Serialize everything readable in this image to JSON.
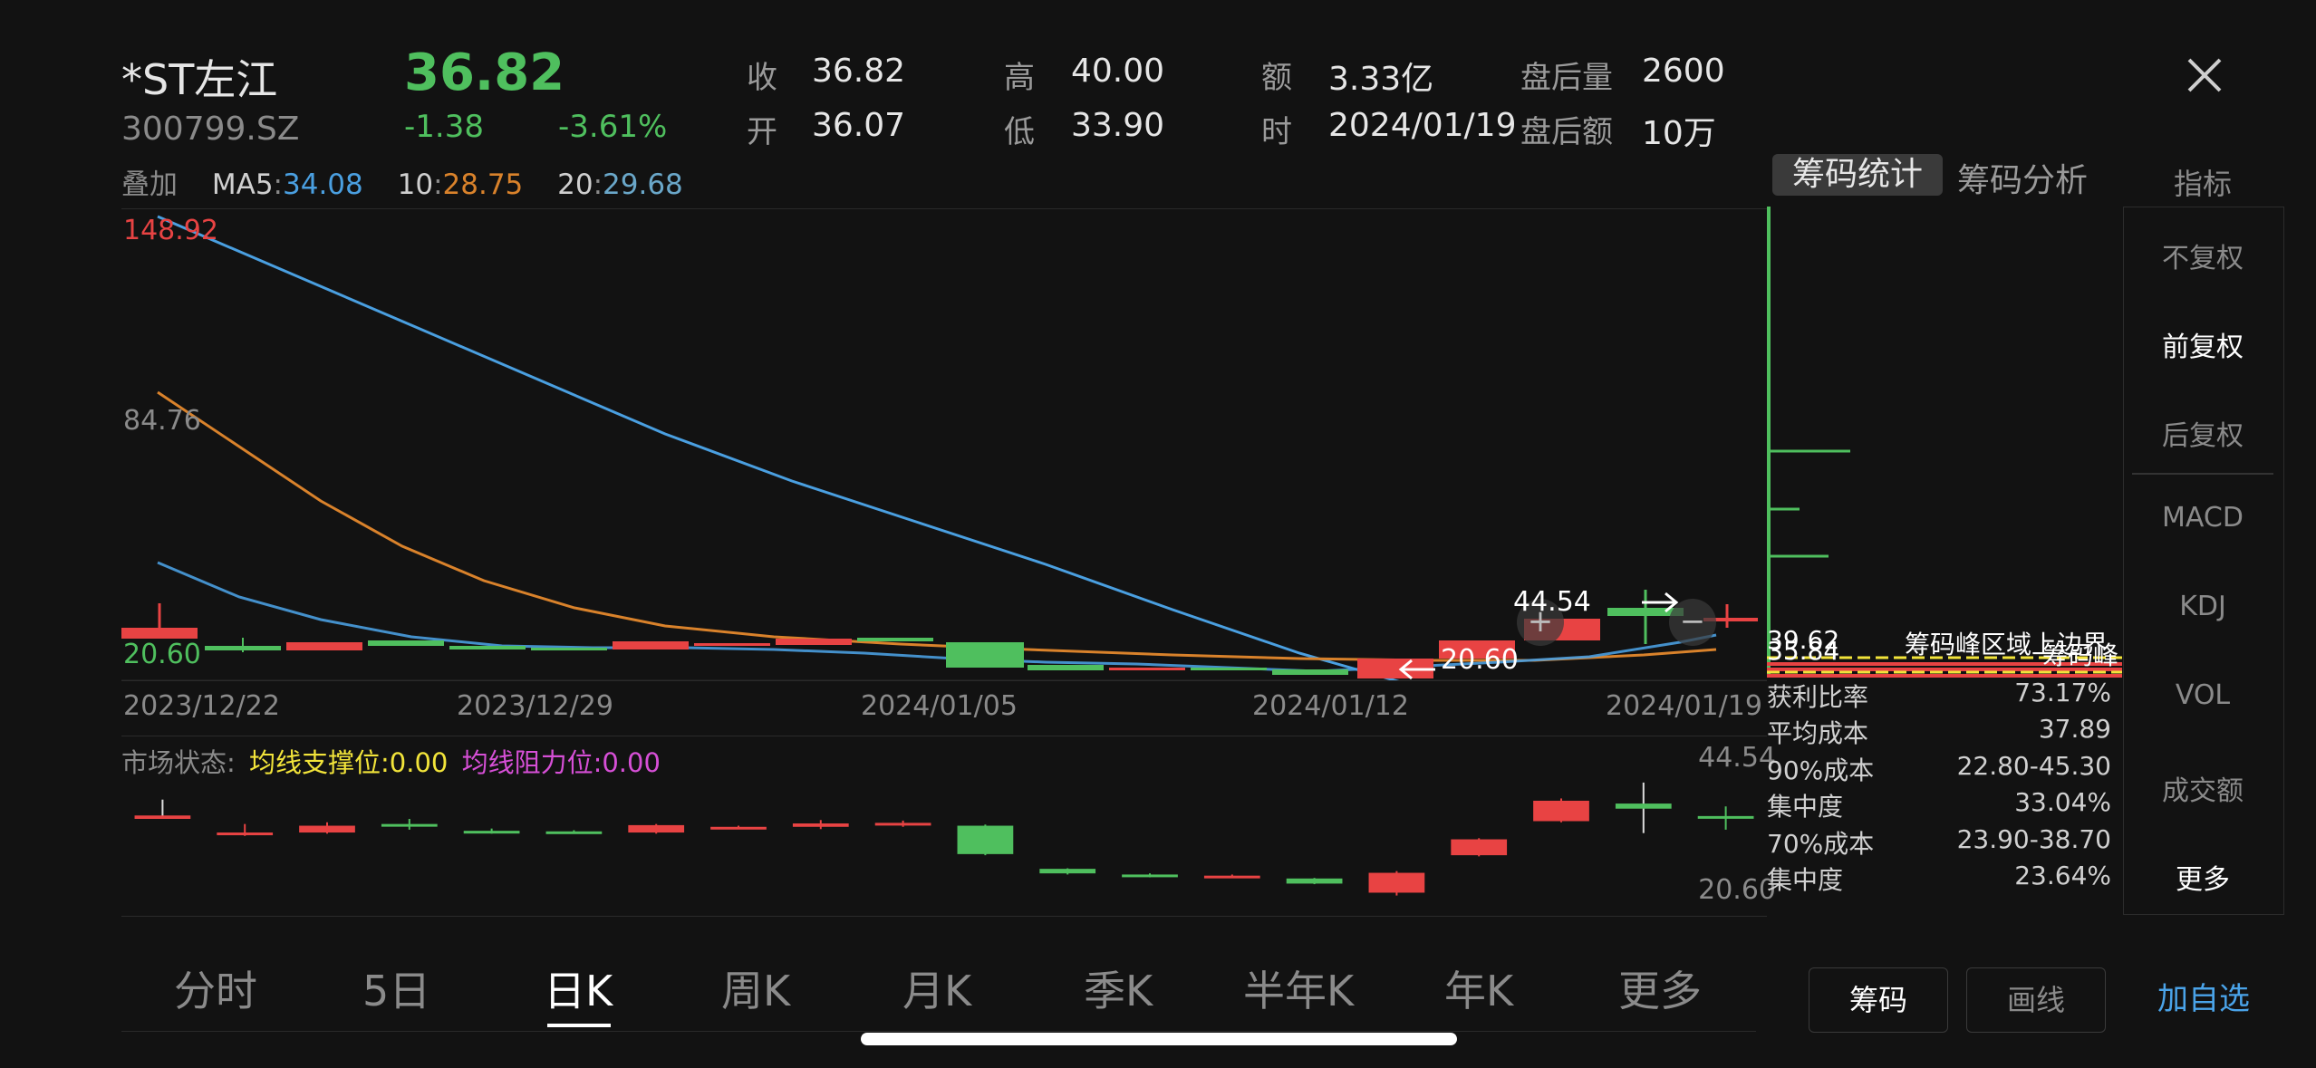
{
  "header": {
    "name": "*ST左江",
    "code": "300799.SZ",
    "price": "36.82",
    "change": "-1.38",
    "change_pct": "-3.61%",
    "fields": [
      {
        "label": "收",
        "value": "36.82"
      },
      {
        "label": "开",
        "value": "36.07"
      },
      {
        "label": "高",
        "value": "40.00"
      },
      {
        "label": "低",
        "value": "33.90"
      },
      {
        "label": "额",
        "value": "3.33亿"
      },
      {
        "label": "时",
        "value": "2024/01/19"
      },
      {
        "label": "盘后量",
        "value": "2600"
      },
      {
        "label": "盘后额",
        "value": "10万"
      }
    ]
  },
  "ma_legend": {
    "overlay": "叠加",
    "ma5_label": "MA5",
    "ma5_value": "34.08",
    "ma10_label": "10",
    "ma10_value": "28.75",
    "ma20_label": "20",
    "ma20_value": "29.68",
    "sep": ":"
  },
  "colors": {
    "up": "#e84343",
    "down": "#4fbf5e",
    "ma5": "#4a9fe0",
    "ma10": "#d9822b",
    "ma20": "#6aa7c9"
  },
  "chart_data": [
    {
      "type": "candlestick",
      "price_labels": {
        "max": "148.92",
        "mid": "84.76",
        "min": "20.60"
      },
      "x_ticks": [
        "2023/12/22",
        "2023/12/29",
        "2024/01/05",
        "2024/01/12",
        "2024/01/19"
      ],
      "annotations": {
        "high_marker": "44.54",
        "low_marker": "20.60"
      },
      "ylim": [
        20.6,
        148.92
      ]
    },
    {
      "type": "candlestick",
      "title_label": "市场状态:",
      "support": "均线支撑位:0.00",
      "resistance": "均线阻力位:0.00",
      "axis_max": "44.54",
      "axis_min": "20.60",
      "ylim": [
        20.6,
        44.54
      ],
      "candles": [
        {
          "o": 36.4,
          "c": 37.0,
          "h": 39.8,
          "l": 36.4
        },
        {
          "o": 34.0,
          "c": 34.0,
          "h": 35.5,
          "l": 33.4
        },
        {
          "o": 34.0,
          "c": 35.2,
          "h": 35.8,
          "l": 33.8
        },
        {
          "o": 35.5,
          "c": 35.3,
          "h": 36.4,
          "l": 34.5
        },
        {
          "o": 34.3,
          "c": 34.1,
          "h": 34.7,
          "l": 33.8
        },
        {
          "o": 34.2,
          "c": 34.1,
          "h": 34.4,
          "l": 33.9
        },
        {
          "o": 34.0,
          "c": 35.3,
          "h": 35.5,
          "l": 33.8
        },
        {
          "o": 34.8,
          "c": 35.0,
          "h": 35.2,
          "l": 34.6
        },
        {
          "o": 35.0,
          "c": 35.6,
          "h": 36.2,
          "l": 34.6
        },
        {
          "o": 35.6,
          "c": 35.7,
          "h": 36.1,
          "l": 35.0
        },
        {
          "o": 35.2,
          "c": 30.2,
          "h": 35.4,
          "l": 30.0
        },
        {
          "o": 27.6,
          "c": 26.8,
          "h": 27.7,
          "l": 26.6
        },
        {
          "o": 26.6,
          "c": 26.3,
          "h": 26.8,
          "l": 26.1
        },
        {
          "o": 26.1,
          "c": 26.4,
          "h": 26.6,
          "l": 26.0
        },
        {
          "o": 25.9,
          "c": 25.0,
          "h": 26.0,
          "l": 24.9
        },
        {
          "o": 23.4,
          "c": 26.9,
          "h": 27.2,
          "l": 22.9
        },
        {
          "o": 30.0,
          "c": 32.8,
          "h": 33.0,
          "l": 29.8
        },
        {
          "o": 36.0,
          "c": 39.6,
          "h": 40.0,
          "l": 35.8
        },
        {
          "o": 39.1,
          "c": 38.2,
          "h": 42.8,
          "l": 33.9
        },
        {
          "o": 36.9,
          "c": 36.8,
          "h": 38.6,
          "l": 34.5
        }
      ]
    }
  ],
  "chips": {
    "tabs": [
      "筹码统计",
      "筹码分析"
    ],
    "overlay_labels": {
      "price_a": "39.62",
      "price_b": "35.84",
      "peak_label": "筹码峰区域上边界",
      "peak_short": "筹码峰"
    },
    "stats": [
      {
        "label": "获利比率",
        "value": "73.17%"
      },
      {
        "label": "平均成本",
        "value": "37.89"
      },
      {
        "label": "90%成本",
        "value": "22.80-45.30"
      },
      {
        "label": "集中度",
        "value": "33.04%"
      },
      {
        "label": "70%成本",
        "value": "23.90-38.70"
      },
      {
        "label": "集中度",
        "value": "23.64%"
      }
    ]
  },
  "side_panel": {
    "title": "指标",
    "items": [
      "不复权",
      "前复权",
      "后复权",
      "MACD",
      "KDJ",
      "VOL",
      "成交额",
      "更多"
    ],
    "active": "前复权"
  },
  "period_tabs": {
    "items": [
      "分时",
      "5日",
      "日K",
      "周K",
      "月K",
      "季K",
      "半年K",
      "年K",
      "更多"
    ],
    "active": "日K"
  },
  "bottom_buttons": {
    "chips": "筹码",
    "draw": "画线",
    "add_watch": "加自选"
  },
  "close_icon": "close-icon",
  "zoom": {
    "plus": "+",
    "minus": "−"
  }
}
